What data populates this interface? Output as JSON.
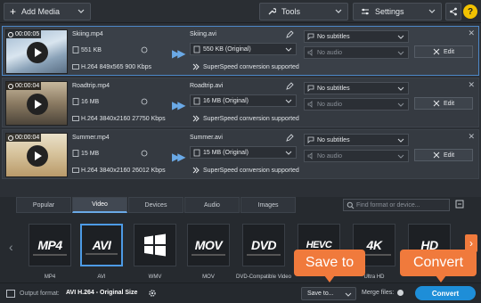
{
  "toolbar": {
    "add_media": "Add Media",
    "tools": "Tools",
    "settings": "Settings",
    "help": "?"
  },
  "files": [
    {
      "time": "00:00:05",
      "src_name": "Skiing.mp4",
      "src_size": "551 KB",
      "src_info": "H.264 849x565 900 Kbps",
      "dst_name": "Skiing.avi",
      "dst_size": "550 KB (Original)",
      "speed": "SuperSpeed conversion supported",
      "subtitles": "No subtitles",
      "audio": "No audio",
      "edit": "Edit"
    },
    {
      "time": "00:00:04",
      "src_name": "Roadtrip.mp4",
      "src_size": "16 MB",
      "src_info": "H.264 3840x2160 27750 Kbps",
      "dst_name": "Roadtrip.avi",
      "dst_size": "16 MB (Original)",
      "speed": "SuperSpeed conversion supported",
      "subtitles": "No subtitles",
      "audio": "No audio",
      "edit": "Edit"
    },
    {
      "time": "00:00:04",
      "src_name": "Summer.mp4",
      "src_size": "15 MB",
      "src_info": "H.264 3840x2160 26012 Kbps",
      "dst_name": "Summer.avi",
      "dst_size": "15 MB (Original)",
      "speed": "SuperSpeed conversion supported",
      "subtitles": "No subtitles",
      "audio": "No audio",
      "edit": "Edit"
    }
  ],
  "format_tabs": [
    "Popular",
    "Video",
    "Devices",
    "Audio",
    "Images"
  ],
  "search_placeholder": "Find format or device...",
  "formats": [
    {
      "logo": "MP4",
      "caption": "MP4"
    },
    {
      "logo": "AVI",
      "caption": "AVI"
    },
    {
      "logo": "",
      "caption": "WMV"
    },
    {
      "logo": "MOV",
      "caption": "MOV"
    },
    {
      "logo": "DVD",
      "caption": "DVD-Compatible Video"
    },
    {
      "logo": "HEVC",
      "caption": ""
    },
    {
      "logo": "4K",
      "caption": "Ultra HD"
    },
    {
      "logo": "HD",
      "caption": ""
    }
  ],
  "bottom": {
    "output_label": "Output format:",
    "output_value": "AVI H.264 - Original Size",
    "save_to": "Save to...",
    "merge": "Merge files:",
    "convert": "Convert"
  },
  "callouts": {
    "save_to": "Save to",
    "convert": "Convert"
  },
  "colors": {
    "accent": "#1e8ed8",
    "callout": "#f07a3c",
    "selection": "#4d88c8"
  }
}
